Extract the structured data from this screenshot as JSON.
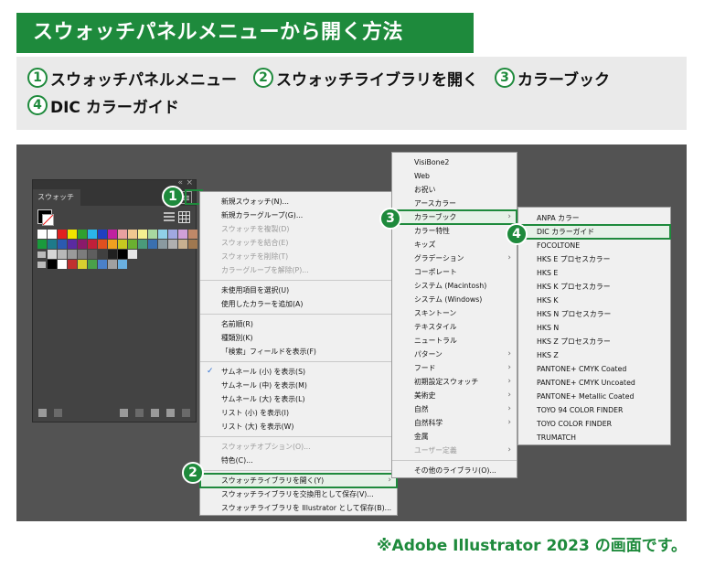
{
  "header": {
    "title": "スウォッチパネルメニューから開く方法"
  },
  "steps": [
    {
      "num": "1",
      "text": "スウォッチパネルメニュー"
    },
    {
      "num": "2",
      "text": "スウォッチライブラリを開く"
    },
    {
      "num": "3",
      "text": "カラーブック"
    },
    {
      "num": "4",
      "text": "DIC カラーガイド"
    }
  ],
  "markers": {
    "m1": "1",
    "m2": "2",
    "m3": "3",
    "m4": "4"
  },
  "panel": {
    "top_icons": "«",
    "close": "×",
    "tab_label": "スウォッチ",
    "swatch_colors": [
      [
        "#ffffff",
        "#ffffff",
        "#e02020",
        "#f2e400",
        "#30a030",
        "#2bb5e8",
        "#2040c0",
        "#c020a0",
        "#e8a0a0",
        "#f0c890",
        "#f4f090",
        "#a8d8a0",
        "#90d0e8",
        "#a0a8e0",
        "#d0a0d8",
        "#c08868"
      ],
      [
        "#1a9a3c",
        "#1d7a8a",
        "#2a5ab0",
        "#5a2aa0",
        "#8a1a6a",
        "#c0203a",
        "#e05020",
        "#f0a020",
        "#c8c820",
        "#6ab030",
        "#4a9a7a",
        "#3a70b0",
        "#8a9aa0",
        "#b0b0b0",
        "#c8b090",
        "#a07850"
      ],
      [
        "#d6d6d6",
        "#b8b8b8",
        "#9a9a9a",
        "#7c7c7c",
        "#5e5e5e",
        "#404040",
        "#202020",
        "#000000",
        "#e8e8e8"
      ],
      [
        "#000000",
        "#ffffff",
        "#c03030",
        "#d8d030",
        "#4aa04a",
        "#4a80c8",
        "#a0a0a0",
        "#6ab0e0"
      ]
    ],
    "accent": "#1e8a3c"
  },
  "menu1": {
    "groups": [
      [
        {
          "label": "新規スウォッチ(N)...",
          "disabled": false
        },
        {
          "label": "新規カラーグループ(G)...",
          "disabled": false
        },
        {
          "label": "スウォッチを複製(D)",
          "disabled": true
        },
        {
          "label": "スウォッチを結合(E)",
          "disabled": true
        },
        {
          "label": "スウォッチを削除(T)",
          "disabled": true
        },
        {
          "label": "カラーグループを解除(P)...",
          "disabled": true
        }
      ],
      [
        {
          "label": "未使用項目を選択(U)",
          "disabled": false
        },
        {
          "label": "使用したカラーを追加(A)",
          "disabled": false
        }
      ],
      [
        {
          "label": "名前順(R)",
          "disabled": false
        },
        {
          "label": "種類別(K)",
          "disabled": false
        },
        {
          "label": "「検索」フィールドを表示(F)",
          "disabled": false
        }
      ],
      [
        {
          "label": "サムネール (小) を表示(S)",
          "disabled": false,
          "checked": true
        },
        {
          "label": "サムネール (中) を表示(M)",
          "disabled": false
        },
        {
          "label": "サムネール (大) を表示(L)",
          "disabled": false
        },
        {
          "label": "リスト (小) を表示(I)",
          "disabled": false
        },
        {
          "label": "リスト (大) を表示(W)",
          "disabled": false
        }
      ],
      [
        {
          "label": "スウォッチオプション(O)...",
          "disabled": true
        },
        {
          "label": "特色(C)...",
          "disabled": false
        }
      ],
      [
        {
          "label": "スウォッチライブラリを開く(Y)",
          "disabled": false,
          "submenu": true,
          "highlight": true
        },
        {
          "label": "スウォッチライブラリを交換用として保存(V)...",
          "disabled": false
        },
        {
          "label": "スウォッチライブラリを Illustrator として保存(B)...",
          "disabled": false
        }
      ]
    ],
    "check_glyph": "✓",
    "arrow_glyph": "›"
  },
  "menu2": {
    "items": [
      {
        "label": "VisiBone2"
      },
      {
        "label": "Web"
      },
      {
        "label": "お祝い"
      },
      {
        "label": "アースカラー"
      },
      {
        "label": "カラーブック",
        "submenu": true,
        "highlight": true
      },
      {
        "label": "カラー特性"
      },
      {
        "label": "キッズ"
      },
      {
        "label": "グラデーション",
        "submenu": true
      },
      {
        "label": "コーポレート"
      },
      {
        "label": "システム (Macintosh)"
      },
      {
        "label": "システム (Windows)"
      },
      {
        "label": "スキントーン"
      },
      {
        "label": "テキスタイル"
      },
      {
        "label": "ニュートラル"
      },
      {
        "label": "パターン",
        "submenu": true
      },
      {
        "label": "フード",
        "submenu": true
      },
      {
        "label": "初期設定スウォッチ",
        "submenu": true
      },
      {
        "label": "美術史",
        "submenu": true
      },
      {
        "label": "自然",
        "submenu": true
      },
      {
        "label": "自然科学",
        "submenu": true
      },
      {
        "label": "金属"
      },
      {
        "label": "ユーザー定義",
        "submenu": true,
        "disabled": true
      }
    ],
    "footer": "その他のライブラリ(O)..."
  },
  "menu3": {
    "items": [
      {
        "label": "ANPA カラー"
      },
      {
        "label": "DIC カラーガイド",
        "highlight": true
      },
      {
        "label": "FOCOLTONE"
      },
      {
        "label": "HKS E プロセスカラー"
      },
      {
        "label": "HKS E"
      },
      {
        "label": "HKS K プロセスカラー"
      },
      {
        "label": "HKS K"
      },
      {
        "label": "HKS N プロセスカラー"
      },
      {
        "label": "HKS N"
      },
      {
        "label": "HKS Z プロセスカラー"
      },
      {
        "label": "HKS Z"
      },
      {
        "label": "PANTONE+ CMYK Coated"
      },
      {
        "label": "PANTONE+ CMYK Uncoated"
      },
      {
        "label": "PANTONE+ Metallic Coated"
      },
      {
        "label": "TOYO 94 COLOR FINDER"
      },
      {
        "label": "TOYO COLOR FINDER"
      },
      {
        "label": "TRUMATCH"
      }
    ]
  },
  "footnote": "※Adobe Illustrator 2023 の画面です。"
}
